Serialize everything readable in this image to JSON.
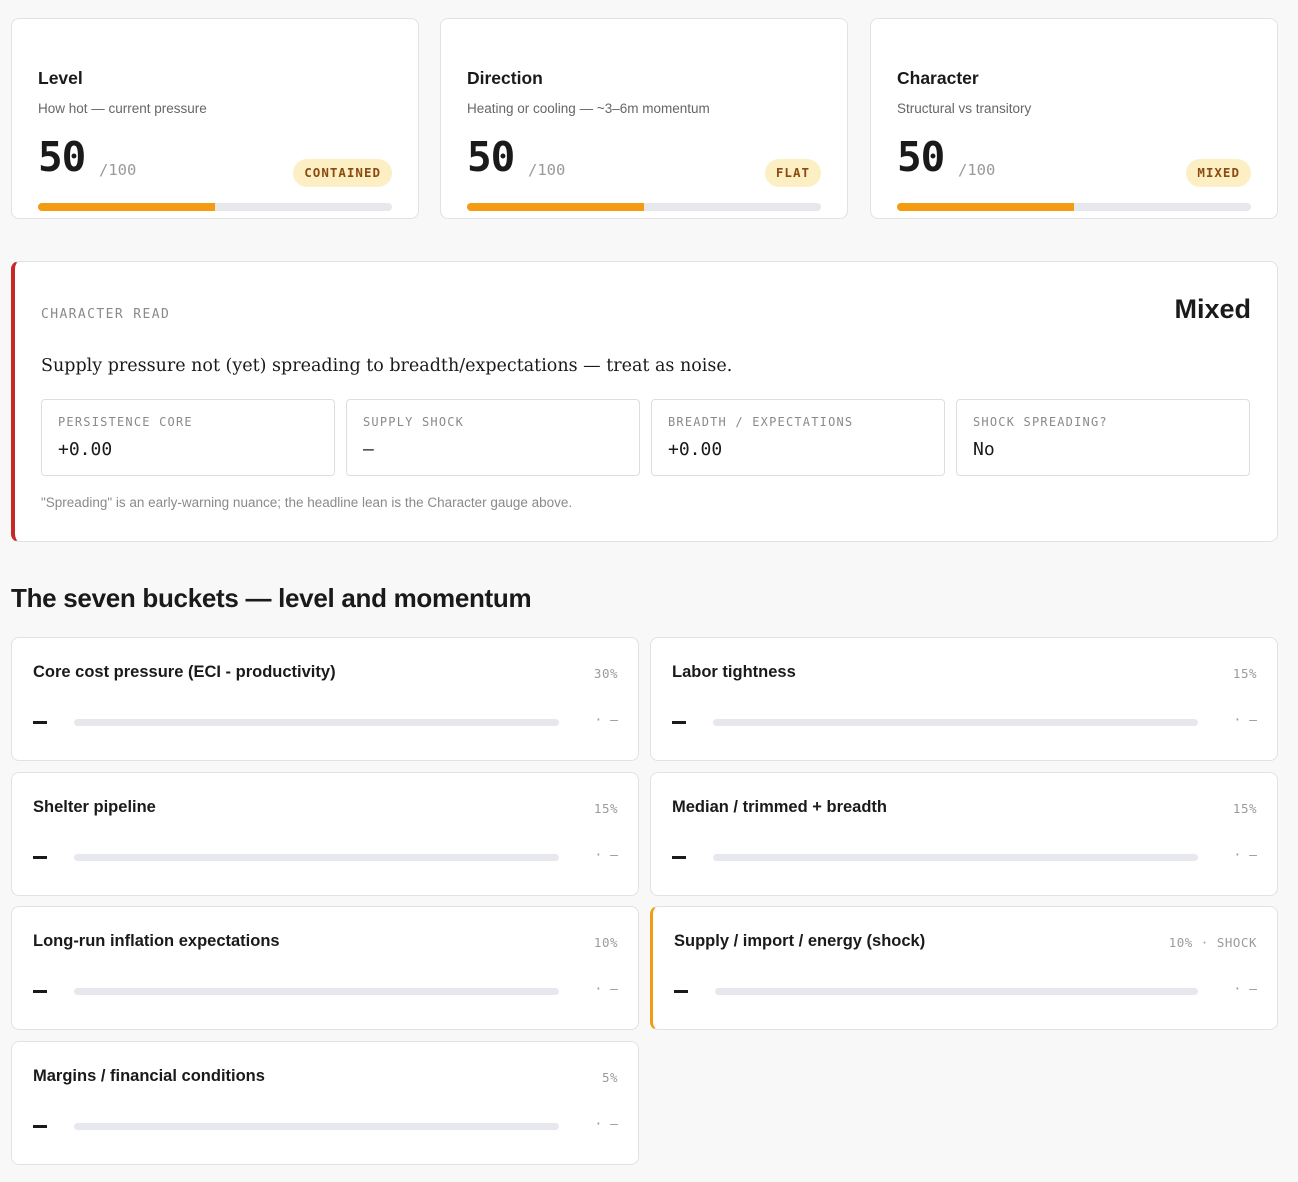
{
  "colors": {
    "accent": "#f39c12",
    "alert": "#c62828",
    "badge_bg": "#fdefc4",
    "badge_text": "#8a4b12",
    "track": "#e6e8ee"
  },
  "gauges": [
    {
      "title": "Level",
      "subtitle": "How hot — current pressure",
      "score": "50",
      "max": "/100",
      "badge": "CONTAINED",
      "fill_pct": 50
    },
    {
      "title": "Direction",
      "subtitle": "Heating or cooling — ~3–6m momentum",
      "score": "50",
      "max": "/100",
      "badge": "FLAT",
      "fill_pct": 50
    },
    {
      "title": "Character",
      "subtitle": "Structural vs transitory",
      "score": "50",
      "max": "/100",
      "badge": "MIXED",
      "fill_pct": 50
    }
  ],
  "character_read": {
    "label": "CHARACTER READ",
    "value": "Mixed",
    "summary": "Supply pressure not (yet) spreading to breadth/expectations — treat as noise.",
    "stats": [
      {
        "label": "PERSISTENCE CORE",
        "value": "+0.00"
      },
      {
        "label": "SUPPLY SHOCK",
        "value": "—"
      },
      {
        "label": "BREADTH / EXPECTATIONS",
        "value": "+0.00"
      },
      {
        "label": "SHOCK SPREADING?",
        "value": "No"
      }
    ],
    "note": "\"Spreading\" is an early-warning nuance; the headline lean is the Character gauge above."
  },
  "buckets_title": "The seven buckets — level and momentum",
  "buckets": [
    {
      "name": "Core cost pressure (ECI - productivity)",
      "weight": "30%",
      "level": "—",
      "momentum": "· —",
      "fill_pct": 0,
      "shock": false
    },
    {
      "name": "Labor tightness",
      "weight": "15%",
      "level": "—",
      "momentum": "· —",
      "fill_pct": 0,
      "shock": false
    },
    {
      "name": "Shelter pipeline",
      "weight": "15%",
      "level": "—",
      "momentum": "· —",
      "fill_pct": 0,
      "shock": false
    },
    {
      "name": "Median / trimmed + breadth",
      "weight": "15%",
      "level": "—",
      "momentum": "· —",
      "fill_pct": 0,
      "shock": false
    },
    {
      "name": "Long-run inflation expectations",
      "weight": "10%",
      "level": "—",
      "momentum": "· —",
      "fill_pct": 0,
      "shock": false
    },
    {
      "name": "Supply / import / energy (shock)",
      "weight": "10% · SHOCK",
      "level": "—",
      "momentum": "· —",
      "fill_pct": 0,
      "shock": true
    },
    {
      "name": "Margins / financial conditions",
      "weight": "5%",
      "level": "—",
      "momentum": "· —",
      "fill_pct": 0,
      "shock": false
    }
  ]
}
